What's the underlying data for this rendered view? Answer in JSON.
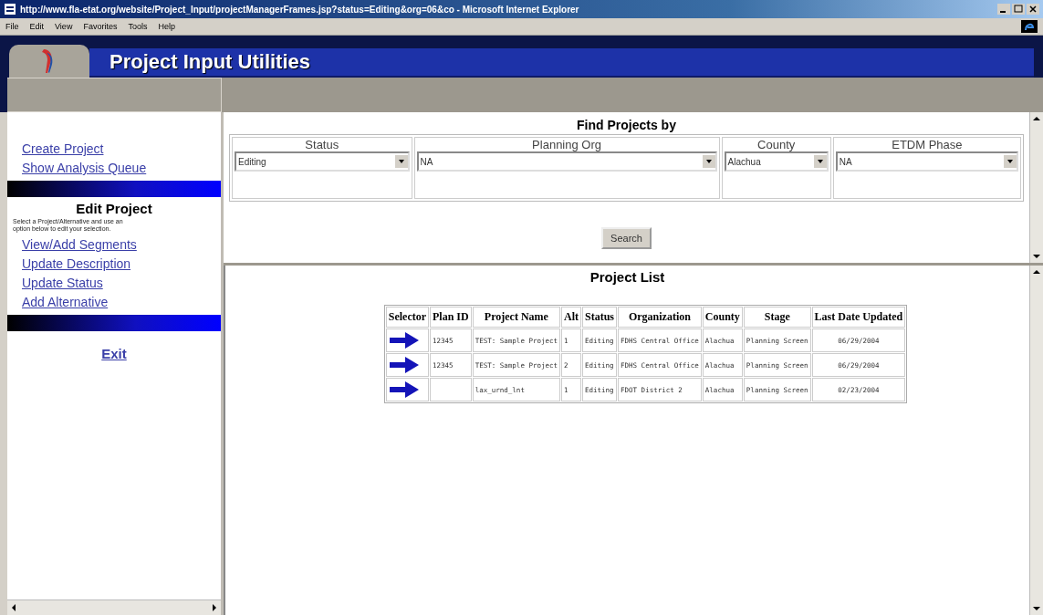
{
  "window": {
    "title": "http://www.fla-etat.org/website/Project_Input/projectManagerFrames.jsp?status=Editing&org=06&co - Microsoft Internet Explorer"
  },
  "menu": [
    "File",
    "Edit",
    "View",
    "Favorites",
    "Tools",
    "Help"
  ],
  "banner": {
    "title": "Project Input Utilities"
  },
  "sidebar": {
    "top_links": [
      "Create Project",
      "Show Analysis Queue"
    ],
    "edit_heading": "Edit Project",
    "edit_note": "Select a Project/Alternative and use an option below to edit your selection.",
    "edit_links": [
      "View/Add Segments",
      "Update Description",
      "Update Status",
      "Add Alternative"
    ],
    "exit": "Exit"
  },
  "search": {
    "heading": "Find Projects by",
    "filters": [
      {
        "label": "Status",
        "value": "Editing"
      },
      {
        "label": "Planning Org",
        "value": "NA"
      },
      {
        "label": "County",
        "value": "Alachua"
      },
      {
        "label": "ETDM Phase",
        "value": "NA"
      }
    ],
    "button": "Search"
  },
  "project_list": {
    "heading": "Project List",
    "columns": [
      "Selector",
      "Plan ID",
      "Project Name",
      "Alt",
      "Status",
      "Organization",
      "County",
      "Stage",
      "Last Date Updated"
    ],
    "rows": [
      {
        "plan_id": "12345",
        "project_name": "TEST: Sample Project",
        "alt": "1",
        "status": "Editing",
        "organization": "FDHS Central Office",
        "county": "Alachua",
        "stage": "Planning Screen",
        "last_date_updated": "06/29/2004"
      },
      {
        "plan_id": "12345",
        "project_name": "TEST: Sample Project",
        "alt": "2",
        "status": "Editing",
        "organization": "FDHS Central Office",
        "county": "Alachua",
        "stage": "Planning Screen",
        "last_date_updated": "06/29/2004"
      },
      {
        "project_name": "lax_urnd_lnt",
        "alt": "1",
        "status": "Editing",
        "organization": "FDOT District 2",
        "county": "Alachua",
        "stage": "Planning Screen",
        "last_date_updated": "02/23/2004"
      }
    ]
  }
}
